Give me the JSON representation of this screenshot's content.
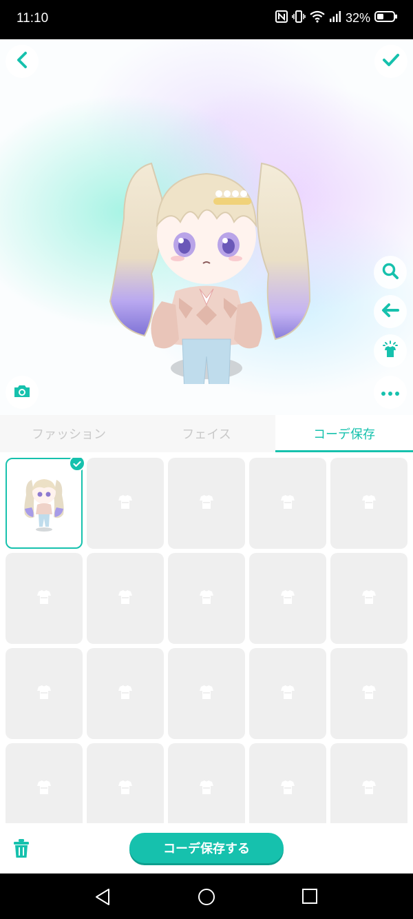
{
  "status": {
    "time": "11:10",
    "battery": "32%"
  },
  "icons": {
    "back": "chevron-left-icon",
    "confirm": "check-icon",
    "search": "search-icon",
    "undo": "arrow-left-icon",
    "wardrobe": "shirt-icon",
    "more": "more-icon",
    "camera": "camera-icon",
    "trash": "trash-icon",
    "slot": "shirt-placeholder-icon"
  },
  "colors": {
    "accent": "#16c1ad",
    "inactive_tab": "#c9c9c9",
    "slot_bg": "#efefef"
  },
  "tabs": [
    {
      "label": "ファッション",
      "active": false
    },
    {
      "label": "フェイス",
      "active": false
    },
    {
      "label": "コーデ保存",
      "active": true
    }
  ],
  "slots": {
    "selected_index": 0
  },
  "actions": {
    "save_label": "コーデ保存する"
  }
}
